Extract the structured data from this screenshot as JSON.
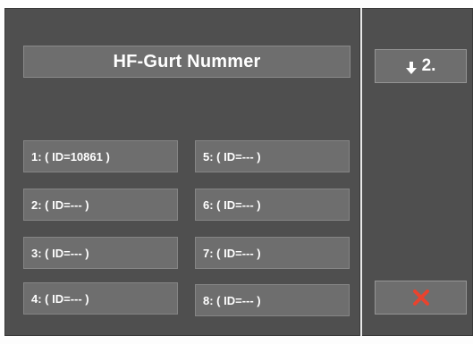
{
  "title": "HF-Gurt Nummer",
  "slots": [
    {
      "label": "1: ( ID=10861 )"
    },
    {
      "label": "2: ( ID=--- )"
    },
    {
      "label": "3: ( ID=--- )"
    },
    {
      "label": "4: ( ID=--- )"
    },
    {
      "label": "5: ( ID=--- )"
    },
    {
      "label": "6: ( ID=--- )"
    },
    {
      "label": "7: ( ID=--- )"
    },
    {
      "label": "8: ( ID=--- )"
    }
  ],
  "next_button": {
    "label": "2.",
    "icon": "arrow-down-icon"
  },
  "close_button": {
    "icon": "close-x-icon"
  },
  "colors": {
    "background": "#4f4f4f",
    "button": "#6e6e6e",
    "text": "#ffffff",
    "close_accent": "#e8432e"
  }
}
